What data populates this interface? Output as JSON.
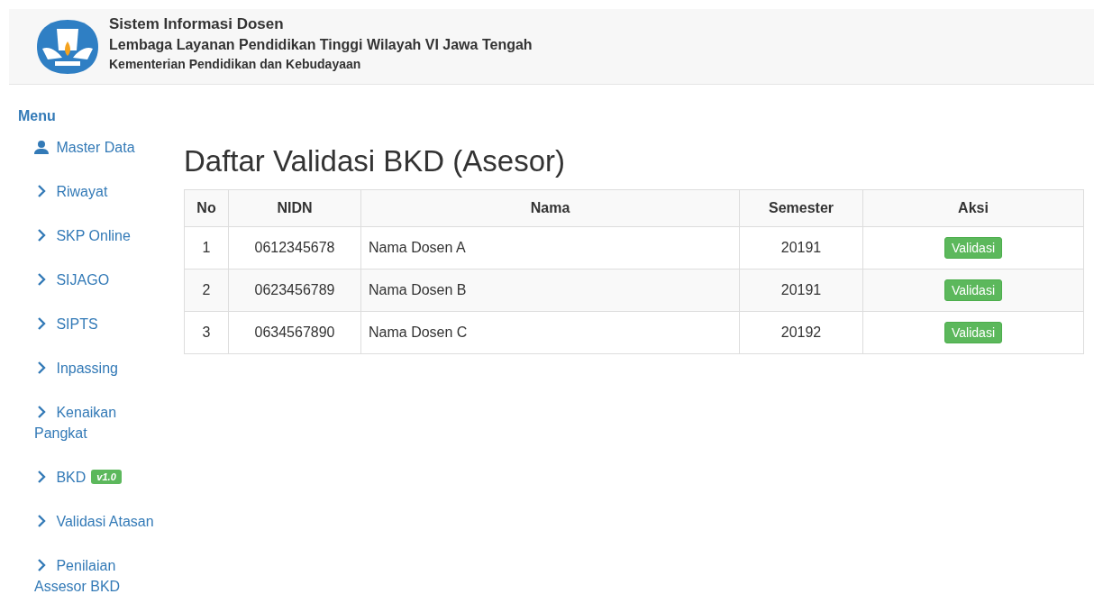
{
  "header": {
    "title": "Sistem Informasi Dosen",
    "subtitle": "Lembaga Layanan Pendidikan Tinggi Wilayah VI Jawa Tengah",
    "ministry": "Kementerian Pendidikan dan Kebudayaan"
  },
  "sidebar": {
    "heading": "Menu",
    "items": [
      {
        "label": "Master Data",
        "kind": "profile"
      },
      {
        "label": "Riwayat",
        "kind": "link"
      },
      {
        "label": "SKP Online",
        "kind": "link"
      },
      {
        "label": "SIJAGO",
        "kind": "link"
      },
      {
        "label": "SIPTS",
        "kind": "link"
      },
      {
        "label": "Inpassing",
        "kind": "link"
      },
      {
        "label": "Kenaikan Pangkat",
        "kind": "link"
      },
      {
        "label": "BKD",
        "kind": "link",
        "badge": "v1.0"
      },
      {
        "label": "Validasi Atasan",
        "kind": "link"
      },
      {
        "label": "Penilaian Assesor BKD",
        "kind": "link"
      }
    ]
  },
  "page_title": "Daftar Validasi BKD (Asesor)",
  "table": {
    "columns": [
      "No",
      "NIDN",
      "Nama",
      "Semester",
      "Aksi"
    ],
    "rows": [
      {
        "no": "1",
        "nidn": "0612345678",
        "nama": "Nama Dosen A",
        "semester": "20191",
        "action": "Validasi"
      },
      {
        "no": "2",
        "nidn": "0623456789",
        "nama": "Nama Dosen B",
        "semester": "20191",
        "action": "Validasi"
      },
      {
        "no": "3",
        "nidn": "0634567890",
        "nama": "Nama Dosen C",
        "semester": "20192",
        "action": "Validasi"
      }
    ]
  }
}
